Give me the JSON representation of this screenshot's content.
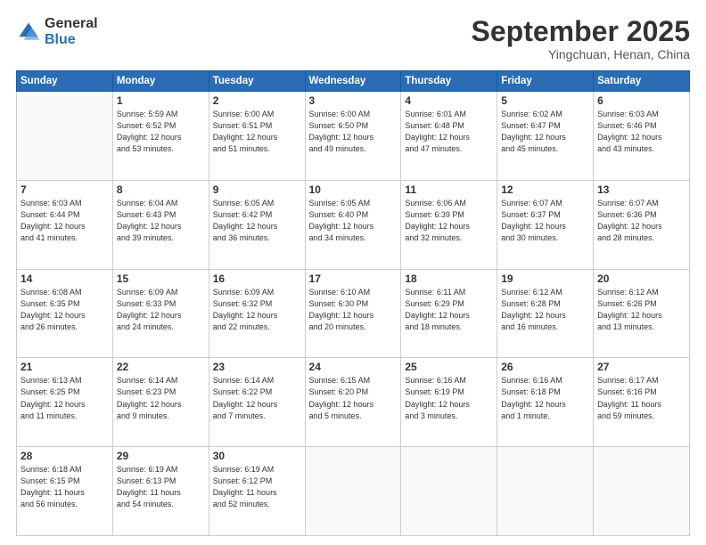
{
  "header": {
    "logo_general": "General",
    "logo_blue": "Blue",
    "month_title": "September 2025",
    "subtitle": "Yingchuan, Henan, China"
  },
  "days_of_week": [
    "Sunday",
    "Monday",
    "Tuesday",
    "Wednesday",
    "Thursday",
    "Friday",
    "Saturday"
  ],
  "weeks": [
    [
      {
        "day": null,
        "info": null
      },
      {
        "day": "1",
        "info": "Sunrise: 5:59 AM\nSunset: 6:52 PM\nDaylight: 12 hours\nand 53 minutes."
      },
      {
        "day": "2",
        "info": "Sunrise: 6:00 AM\nSunset: 6:51 PM\nDaylight: 12 hours\nand 51 minutes."
      },
      {
        "day": "3",
        "info": "Sunrise: 6:00 AM\nSunset: 6:50 PM\nDaylight: 12 hours\nand 49 minutes."
      },
      {
        "day": "4",
        "info": "Sunrise: 6:01 AM\nSunset: 6:48 PM\nDaylight: 12 hours\nand 47 minutes."
      },
      {
        "day": "5",
        "info": "Sunrise: 6:02 AM\nSunset: 6:47 PM\nDaylight: 12 hours\nand 45 minutes."
      },
      {
        "day": "6",
        "info": "Sunrise: 6:03 AM\nSunset: 6:46 PM\nDaylight: 12 hours\nand 43 minutes."
      }
    ],
    [
      {
        "day": "7",
        "info": "Sunrise: 6:03 AM\nSunset: 6:44 PM\nDaylight: 12 hours\nand 41 minutes."
      },
      {
        "day": "8",
        "info": "Sunrise: 6:04 AM\nSunset: 6:43 PM\nDaylight: 12 hours\nand 39 minutes."
      },
      {
        "day": "9",
        "info": "Sunrise: 6:05 AM\nSunset: 6:42 PM\nDaylight: 12 hours\nand 36 minutes."
      },
      {
        "day": "10",
        "info": "Sunrise: 6:05 AM\nSunset: 6:40 PM\nDaylight: 12 hours\nand 34 minutes."
      },
      {
        "day": "11",
        "info": "Sunrise: 6:06 AM\nSunset: 6:39 PM\nDaylight: 12 hours\nand 32 minutes."
      },
      {
        "day": "12",
        "info": "Sunrise: 6:07 AM\nSunset: 6:37 PM\nDaylight: 12 hours\nand 30 minutes."
      },
      {
        "day": "13",
        "info": "Sunrise: 6:07 AM\nSunset: 6:36 PM\nDaylight: 12 hours\nand 28 minutes."
      }
    ],
    [
      {
        "day": "14",
        "info": "Sunrise: 6:08 AM\nSunset: 6:35 PM\nDaylight: 12 hours\nand 26 minutes."
      },
      {
        "day": "15",
        "info": "Sunrise: 6:09 AM\nSunset: 6:33 PM\nDaylight: 12 hours\nand 24 minutes."
      },
      {
        "day": "16",
        "info": "Sunrise: 6:09 AM\nSunset: 6:32 PM\nDaylight: 12 hours\nand 22 minutes."
      },
      {
        "day": "17",
        "info": "Sunrise: 6:10 AM\nSunset: 6:30 PM\nDaylight: 12 hours\nand 20 minutes."
      },
      {
        "day": "18",
        "info": "Sunrise: 6:11 AM\nSunset: 6:29 PM\nDaylight: 12 hours\nand 18 minutes."
      },
      {
        "day": "19",
        "info": "Sunrise: 6:12 AM\nSunset: 6:28 PM\nDaylight: 12 hours\nand 16 minutes."
      },
      {
        "day": "20",
        "info": "Sunrise: 6:12 AM\nSunset: 6:26 PM\nDaylight: 12 hours\nand 13 minutes."
      }
    ],
    [
      {
        "day": "21",
        "info": "Sunrise: 6:13 AM\nSunset: 6:25 PM\nDaylight: 12 hours\nand 11 minutes."
      },
      {
        "day": "22",
        "info": "Sunrise: 6:14 AM\nSunset: 6:23 PM\nDaylight: 12 hours\nand 9 minutes."
      },
      {
        "day": "23",
        "info": "Sunrise: 6:14 AM\nSunset: 6:22 PM\nDaylight: 12 hours\nand 7 minutes."
      },
      {
        "day": "24",
        "info": "Sunrise: 6:15 AM\nSunset: 6:20 PM\nDaylight: 12 hours\nand 5 minutes."
      },
      {
        "day": "25",
        "info": "Sunrise: 6:16 AM\nSunset: 6:19 PM\nDaylight: 12 hours\nand 3 minutes."
      },
      {
        "day": "26",
        "info": "Sunrise: 6:16 AM\nSunset: 6:18 PM\nDaylight: 12 hours\nand 1 minute."
      },
      {
        "day": "27",
        "info": "Sunrise: 6:17 AM\nSunset: 6:16 PM\nDaylight: 11 hours\nand 59 minutes."
      }
    ],
    [
      {
        "day": "28",
        "info": "Sunrise: 6:18 AM\nSunset: 6:15 PM\nDaylight: 11 hours\nand 56 minutes."
      },
      {
        "day": "29",
        "info": "Sunrise: 6:19 AM\nSunset: 6:13 PM\nDaylight: 11 hours\nand 54 minutes."
      },
      {
        "day": "30",
        "info": "Sunrise: 6:19 AM\nSunset: 6:12 PM\nDaylight: 11 hours\nand 52 minutes."
      },
      {
        "day": null,
        "info": null
      },
      {
        "day": null,
        "info": null
      },
      {
        "day": null,
        "info": null
      },
      {
        "day": null,
        "info": null
      }
    ]
  ]
}
